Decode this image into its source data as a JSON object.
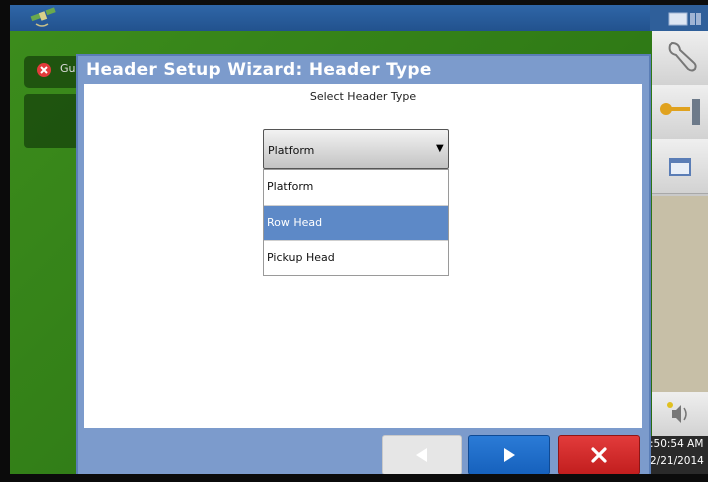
{
  "status": {
    "error_label": "Gu",
    "time": ":50:54 AM",
    "date": "2/21/2014"
  },
  "dialog": {
    "title": "Header Setup Wizard:  Header Type",
    "subtitle": "Select Header Type",
    "dropdown_value": "Platform",
    "options": [
      "Platform",
      "Row Head",
      "Pickup Head"
    ],
    "selected_index": 1
  },
  "icons": {
    "gps": "gps-satellite-icon",
    "error": "error-x-icon",
    "wrench": "wrench-icon",
    "key": "key-icon",
    "window": "window-icon",
    "speaker": "speaker-icon",
    "back": "back-arrow-icon",
    "next": "next-arrow-icon",
    "close": "close-icon"
  },
  "colors": {
    "title_bar": "#2f66a8",
    "dialog": "#7c9bcc",
    "selected_option": "#5d89c7",
    "next_button": "#1f6fca",
    "close_button": "#d22c2c"
  }
}
